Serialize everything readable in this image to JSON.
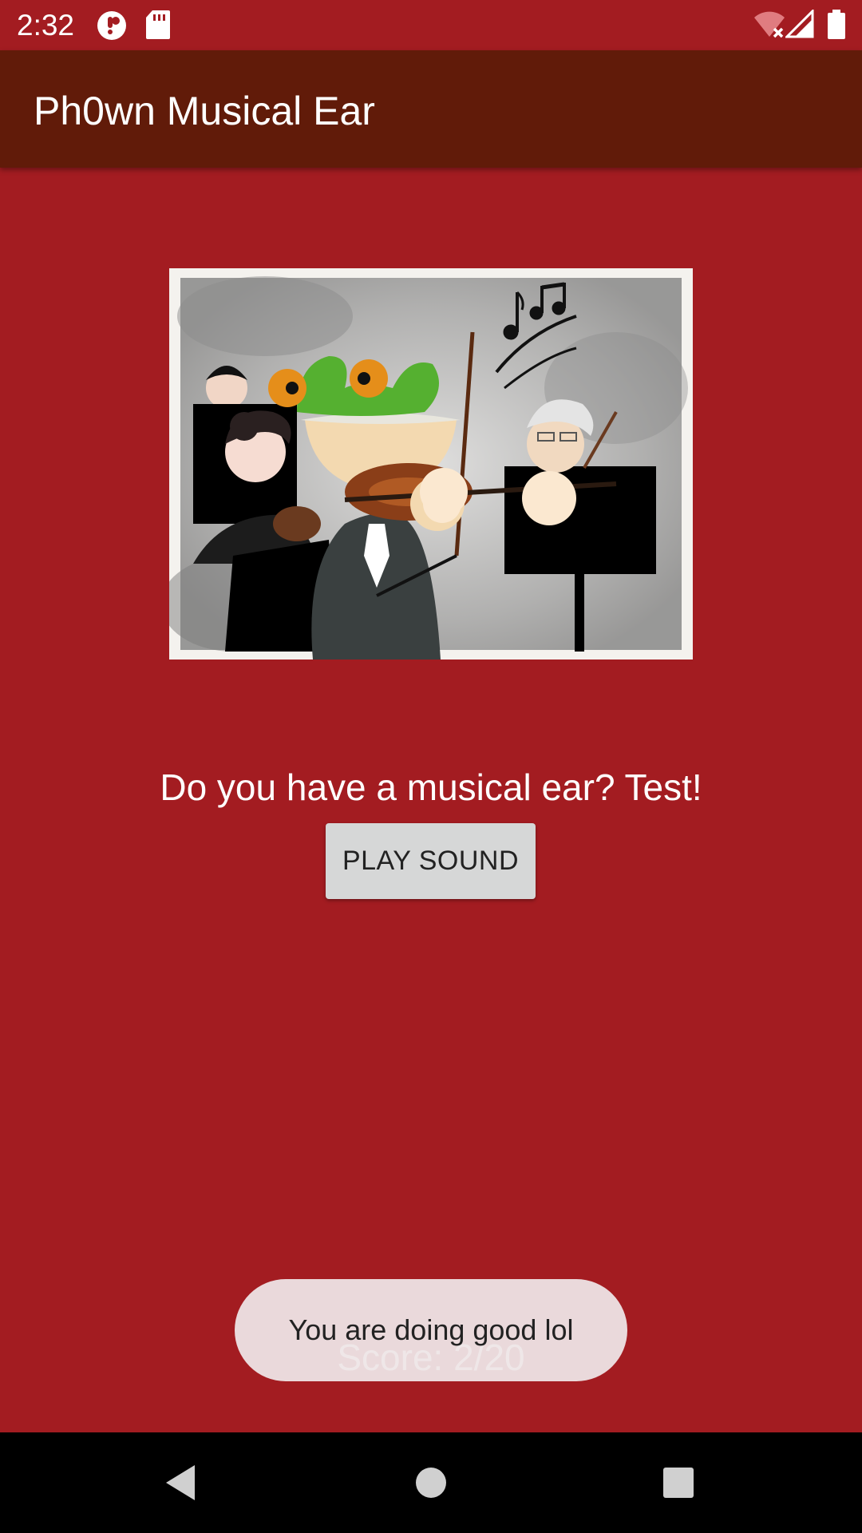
{
  "status_bar": {
    "time": "2:32",
    "icons": [
      "notification-icon",
      "sd-card-icon",
      "wifi-off-icon",
      "signal-icon",
      "battery-icon"
    ]
  },
  "app_bar": {
    "title": "Ph0wn Musical Ear"
  },
  "main": {
    "illustration_name": "orchestra-illustration",
    "prompt": "Do you have a musical ear? Test!",
    "play_button_label": "PLAY SOUND",
    "score": "Score: 2/20"
  },
  "toast": {
    "message": "You are doing good lol"
  },
  "nav_bar": {
    "buttons": [
      "back-icon",
      "home-icon",
      "recents-icon"
    ]
  },
  "colors": {
    "background": "#a31c21",
    "app_bar": "#611b09",
    "button": "#d6d7d7",
    "toast": "#eee6e7"
  }
}
